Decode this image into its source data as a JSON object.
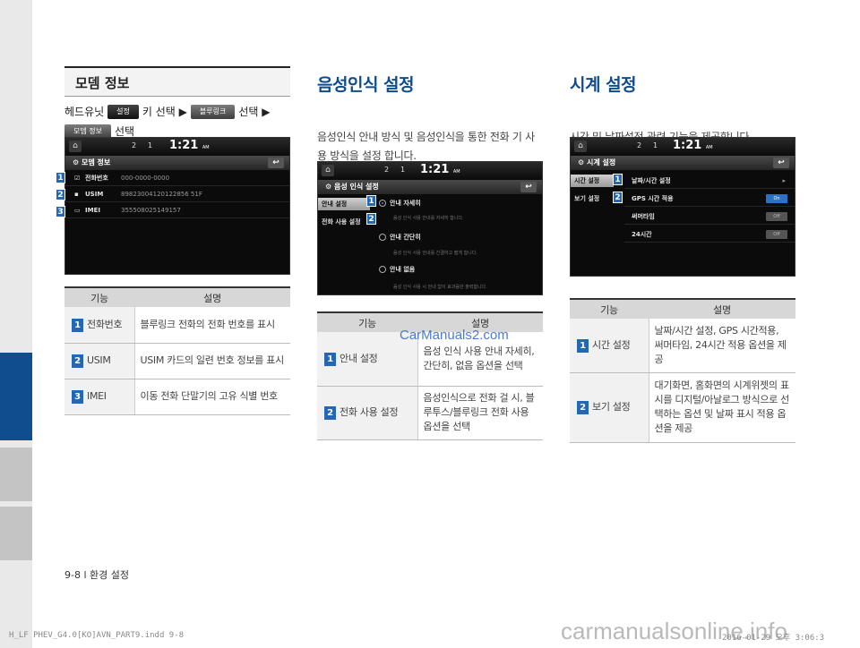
{
  "modem": {
    "title": "모뎀 정보",
    "path_prefix": "헤드유닛",
    "chip_settings": "설정",
    "path_key": "키 선택 ▶",
    "chip_bluelink": "블루링크",
    "path_select": "선택 ▶",
    "chip_modem": "모뎀 정보",
    "path_select2": "선택",
    "screen": {
      "status_signal": "2",
      "status_sub": "1",
      "time": "1:21",
      "am": "AM",
      "header": "모뎀 정보",
      "rows": [
        {
          "label": "전화번호",
          "value": "000-0000-0000"
        },
        {
          "label": "USIM",
          "value": "89823004120122856 51F"
        },
        {
          "label": "IMEI",
          "value": "355508025149157"
        }
      ]
    },
    "table": {
      "headers": [
        "기능",
        "설명"
      ],
      "rows": [
        {
          "num": "1",
          "key": "전화번호",
          "desc": "블루링크 전화의 전화 번호를 표시"
        },
        {
          "num": "2",
          "key": "USIM",
          "desc": "USIM 카드의 일련 번호 정보를 표시"
        },
        {
          "num": "3",
          "key": "IMEI",
          "desc": "이동 전화 단말기의 고유 식별 번호"
        }
      ]
    }
  },
  "voice": {
    "title": "음성인식 설정",
    "body": "음성인식 안내 방식 및 음성인식을 통한 전화 기 사용 방식을 설정 합니다.",
    "screen": {
      "status_signal": "2",
      "status_sub": "1",
      "time": "1:21",
      "am": "AM",
      "header": "음성 인식 설정",
      "tab1": "안내 설정",
      "tab2": "전화 사용 설정",
      "opt1": "안내 자세히",
      "opt1_sub": "음성 인식 사용 안내를 자세히 합니다.",
      "opt2": "안내 간단히",
      "opt2_sub": "음성 인식 사용 안내를 간결하고 짧게 합니다.",
      "opt3": "안내 없음",
      "opt3_sub": "음성 인식 사용 시 안내 없이 효과음만 출력합니다."
    },
    "table": {
      "headers": [
        "기능",
        "설명"
      ],
      "rows": [
        {
          "num": "1",
          "key": "안내 설정",
          "desc": "음성 인식 사용 안내 자세히, 간단히, 없음 옵션을 선택"
        },
        {
          "num": "2",
          "key": "전화 사용 설정",
          "desc": "음성인식으로 전화 걸 시, 블루투스/블루링크 전화 사용 옵션을 선택"
        }
      ]
    }
  },
  "clock": {
    "title": "시계 설정",
    "body": "시간 및 날짜설정 관련 기능을 제공합니다.",
    "screen": {
      "status_signal": "2",
      "status_sub": "1",
      "time": "1:21",
      "am": "AM",
      "header": "시계 설정",
      "tab1": "시간 설정",
      "tab2": "보기 설정",
      "item1": "날짜/시간 설정",
      "item2": "GPS 시간 적용",
      "item2_toggle": "On",
      "item3": "써머타임",
      "item3_toggle": "Off",
      "item4": "24시간",
      "item4_toggle": "Off"
    },
    "table": {
      "headers": [
        "기능",
        "설명"
      ],
      "rows": [
        {
          "num": "1",
          "key": "시간 설정",
          "desc": "날짜/시간 설정, GPS 시간적용, 써머타임, 24시간 적용 옵션을 제공"
        },
        {
          "num": "2",
          "key": "보기 설정",
          "desc": "대기화면, 홈화면의 시계위젯의 표시를 디지털/아날로그 방식으로 선택하는 옵션 및 날짜 표시 적용 옵션을 제공"
        }
      ]
    }
  },
  "footer": {
    "page": "9-8 l 환경 설정",
    "meta": "H_LF PHEV_G4.0[KO]AVN_PART9.indd   9-8",
    "date": "2016-01-29   오후 3:06:3",
    "watermark_center": "CarManuals2.com",
    "watermark_bottom": "carmanualsonline.info"
  },
  "colors": {
    "accent": "#0e4c8c",
    "badge": "#2467b3",
    "sidebar": "#e9e9e9",
    "sidebar_active": "#0f4d8e"
  }
}
